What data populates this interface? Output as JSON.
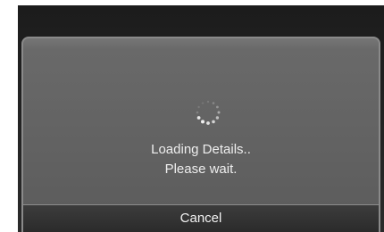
{
  "dialog": {
    "message_line1": "Loading Details..",
    "message_line2": "Please wait.",
    "cancel_label": "Cancel"
  },
  "icons": {
    "spinner": "loading-spinner-icon"
  },
  "colors": {
    "screen_background": "#222222",
    "dialog_background": "#636363",
    "dialog_border": "#8a8a8a",
    "text": "#eeeeee",
    "cancel_background": "#333333"
  }
}
